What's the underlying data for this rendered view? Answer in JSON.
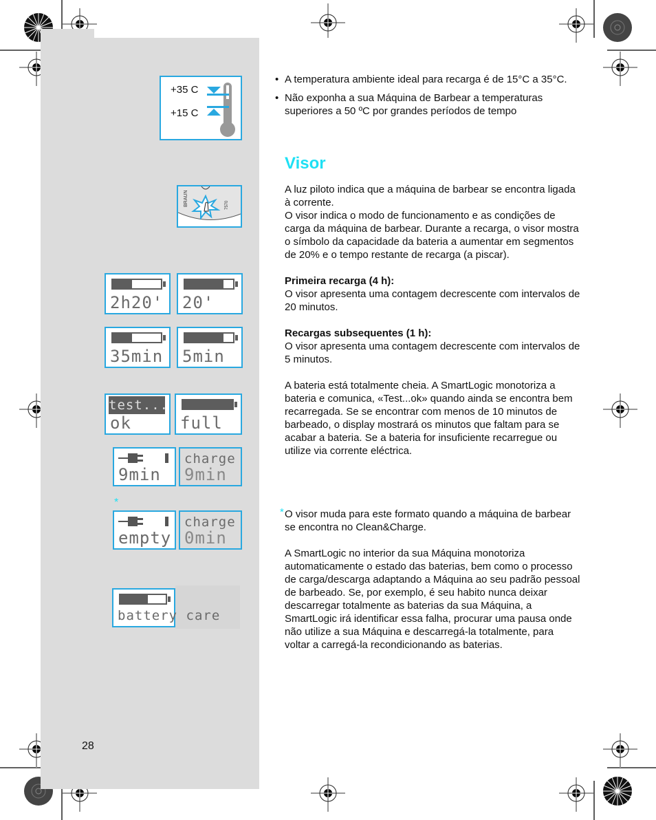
{
  "page": {
    "number": "28"
  },
  "figures": {
    "thermometer": {
      "upper_label": "+35  C",
      "lower_label": "+15  C",
      "accent": "#29a8e0"
    },
    "shaver_closeup": {
      "brand": "BRAUN",
      "model": "7570"
    },
    "lcd_displays": [
      {
        "id": "charge-first-a",
        "battery_fill_percent": 40,
        "line1": "2h20'",
        "style": "normal"
      },
      {
        "id": "charge-first-b",
        "battery_fill_percent": 80,
        "line1": "20'",
        "style": "normal"
      },
      {
        "id": "charge-subseq-a",
        "battery_fill_percent": 40,
        "line1": "35min",
        "style": "normal"
      },
      {
        "id": "charge-subseq-b",
        "battery_fill_percent": 80,
        "line1": "5min",
        "style": "normal"
      },
      {
        "id": "test-ok",
        "header": "test...",
        "line1": "ok",
        "style": "normal"
      },
      {
        "id": "full",
        "battery_fill_percent": 100,
        "line1": "full",
        "style": "normal"
      },
      {
        "id": "low-plug",
        "icons": "plug-battery",
        "line1": "9min",
        "style": "normal"
      },
      {
        "id": "low-charge",
        "header": "charge",
        "line1": "9min",
        "style": "dim"
      },
      {
        "id": "empty-plug",
        "icons": "plug-battery",
        "line1": "empty",
        "style": "normal"
      },
      {
        "id": "empty-charge",
        "header": "charge",
        "line1": "0min",
        "style": "dim"
      },
      {
        "id": "battery-care",
        "battery_fill_percent": 60,
        "line1": "battery care",
        "style": "normal"
      }
    ],
    "asterisk": "*"
  },
  "content": {
    "bullets": [
      "A temperatura ambiente ideal para recarga é de 15°C a 35°C.",
      "Não exponha a sua Máquina de Barbear a temperaturas superiores a 50 ºC por grandes períodos de tempo"
    ],
    "heading": "Visor",
    "heading_color": "#1ee0f4",
    "intro": [
      "A luz piloto indica que a máquina de barbear se encontra ligada à corrente.",
      "O visor indica o modo de funcionamento e as condições de carga da máquina de barbear. Durante a recarga, o visor mostra o símbolo da capacidade da bateria a aumentar em segmentos de 20% e o tempo restante de recarga (a piscar)."
    ],
    "first_charge": {
      "title": "Primeira recarga (4 h):",
      "body": "O visor apresenta uma contagem decrescente com intervalos de 20 minutos."
    },
    "subsequent_charge": {
      "title": "Recargas subsequentes (1 h):",
      "body": "O visor apresenta uma contagem decrescente com intervalos de 5 minutos."
    },
    "full_battery": "A bateria está totalmente cheia. A SmartLogic monotoriza a bateria e comunica, «Test...ok» quando ainda se encontra bem recarregada. Se se encontrar com menos de 10 minutos de barbeado, o display mostrará os minutos que faltam para se acabar a bateria. Se a bateria for insuficiente recarregue ou utilize via corrente eléctrica.",
    "footnote_marker": "*",
    "footnote": "O visor muda para este formato quando a máquina de barbear se encontra no Clean&Charge.",
    "smartlogic": "A SmartLogic no interior da sua Máquina monotoriza automaticamente o estado das baterias, bem como o processo de carga/descarga adaptando a Máquina ao seu padrão pessoal de barbeado. Se, por exemplo, é seu habito nunca deixar descarregar totalmente as baterias da sua Máquina, a SmartLogic irá identificar essa falha, procurar uma pausa onde não utilize a sua Máquina e descarregá-la totalmente, para voltar a carregá-la recondicionando as baterias."
  }
}
